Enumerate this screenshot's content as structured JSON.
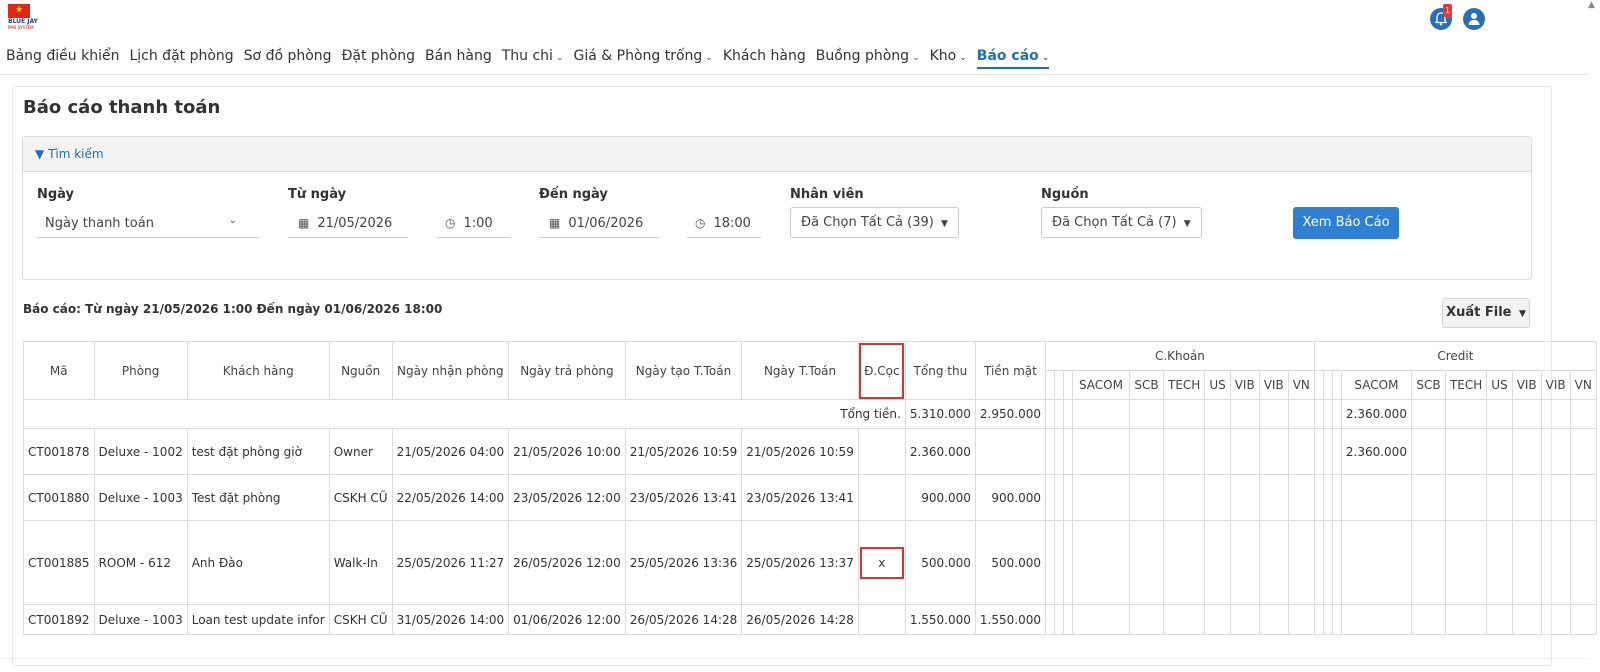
{
  "app": {
    "logo_text": "BLUE JAY",
    "logo_sub": "PMS SYSTEM",
    "notification_count": "1"
  },
  "nav": {
    "items": [
      {
        "label": "Bảng điều khiển",
        "has_menu": false
      },
      {
        "label": "Lịch đặt phòng",
        "has_menu": false
      },
      {
        "label": "Sơ đồ phòng",
        "has_menu": false
      },
      {
        "label": "Đặt phòng",
        "has_menu": false
      },
      {
        "label": "Bán hàng",
        "has_menu": false
      },
      {
        "label": "Thu chi",
        "has_menu": true
      },
      {
        "label": "Giá & Phòng trống",
        "has_menu": true
      },
      {
        "label": "Khách hàng",
        "has_menu": false
      },
      {
        "label": "Buồng phòng",
        "has_menu": true
      },
      {
        "label": "Kho",
        "has_menu": true
      },
      {
        "label": "Báo cáo",
        "has_menu": true,
        "active": true
      }
    ]
  },
  "page": {
    "title": "Báo cáo thanh toán"
  },
  "search": {
    "header": "Tìm kiếm",
    "date_label": "Ngày",
    "date_type": "Ngày thanh toán",
    "from_label": "Từ ngày",
    "from_date": "21/05/2026",
    "from_time": "1:00",
    "to_label": "Đến ngày",
    "to_date": "01/06/2026",
    "to_time": "18:00",
    "staff_label": "Nhân viên",
    "staff_value": "Đã Chọn Tất Cả (39)",
    "source_label": "Nguồn",
    "source_value": "Đã Chọn Tất Cả (7)",
    "submit_label": "Xem Báo Cáo"
  },
  "report": {
    "range_text": "Báo cáo: Từ ngày 21/05/2026 1:00 Đến ngày 01/06/2026 18:00",
    "export_label": "Xuất File"
  },
  "table": {
    "headers": [
      "Mã",
      "Phòng",
      "Khách hàng",
      "Nguồn",
      "Ngày nhận phòng",
      "Ngày trả phòng",
      "Ngày tạo T.Toán",
      "Ngày T.Toán",
      "Đ.Cọc",
      "Tổng thu",
      "Tiền mặt"
    ],
    "transfer_group": "C.Khoản",
    "credit_group": "Credit",
    "bank_columns": [
      "SACOM",
      "SCB",
      "TECH",
      "US",
      "VIB",
      "VIB",
      "VN"
    ],
    "totals": {
      "label": "Tổng tiền.",
      "total": "5.310.000",
      "cash": "2.950.000",
      "credit_sacom": "2.360.000"
    },
    "rows": [
      {
        "code": "CT001878",
        "room": "Deluxe - 1002",
        "guest": "test đặt phòng giờ",
        "source": "Owner",
        "checkin": "21/05/2026 04:00",
        "checkout": "21/05/2026 10:00",
        "created": "21/05/2026 10:59",
        "paid": "21/05/2026 10:59",
        "deposit": "",
        "total": "2.360.000",
        "cash": "",
        "credit_sacom": "2.360.000"
      },
      {
        "code": "CT001880",
        "room": "Deluxe - 1003",
        "guest": "Test đặt phòng",
        "source": "CSKH CŨ",
        "checkin": "22/05/2026 14:00",
        "checkout": "23/05/2026 12:00",
        "created": "23/05/2026 13:41",
        "paid": "23/05/2026 13:41",
        "deposit": "",
        "total": "900.000",
        "cash": "900.000",
        "credit_sacom": ""
      },
      {
        "code": "CT001885",
        "room": "ROOM - 612",
        "guest": "Anh Đào",
        "source": "Walk-In",
        "checkin": "25/05/2026 11:27",
        "checkout": "26/05/2026 12:00",
        "created": "25/05/2026 13:36",
        "paid": "25/05/2026 13:37",
        "deposit": "x",
        "total": "500.000",
        "cash": "500.000",
        "credit_sacom": ""
      },
      {
        "code": "CT001892",
        "room": "Deluxe - 1003",
        "guest": "Loan test update infor",
        "source": "CSKH CŨ",
        "checkin": "31/05/2026 14:00",
        "checkout": "01/06/2026 12:00",
        "created": "26/05/2026 14:28",
        "paid": "26/05/2026 14:28",
        "deposit": "",
        "total": "1.550.000",
        "cash": "1.550.000",
        "credit_sacom": ""
      }
    ]
  },
  "colors": {
    "accent": "#2f7fd3",
    "nav_active": "#1f6fb2",
    "highlight": "#e03030"
  }
}
